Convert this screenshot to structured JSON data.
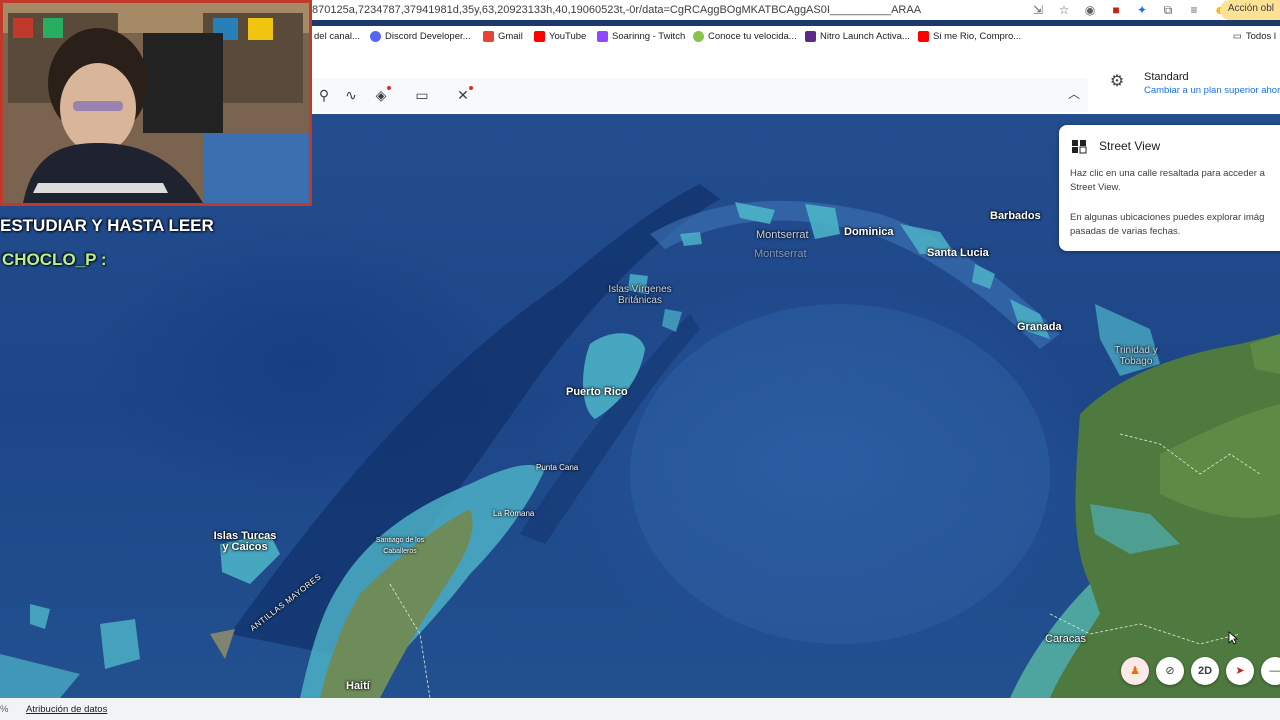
{
  "browser": {
    "url": "870125a,7234787,37941981d,35y,63,20923133h,40,19060523t,-0r/data=CgRCAggBOgMKATBCAggAS0I__________ARAA",
    "action_button": "Acción obl",
    "toolbar_icons": [
      "install-icon",
      "star-icon",
      "extension-icon",
      "pdf-icon",
      "sync-icon",
      "puzzle-icon",
      "media-icon",
      "avatar-icon"
    ]
  },
  "bookmarks": {
    "items": [
      {
        "label": "del canal...",
        "color": "#ffffff"
      },
      {
        "label": "Discord Developer...",
        "color": "#5865f2"
      },
      {
        "label": "Gmail",
        "color": "#ea4335"
      },
      {
        "label": "YouTube",
        "color": "#ff0000"
      },
      {
        "label": "Soarinng - Twitch",
        "color": "#9146ff"
      },
      {
        "label": "Conoce tu velocida...",
        "color": "#8bc34a"
      },
      {
        "label": "Nitro Launch Activa...",
        "color": "#5b2a86"
      },
      {
        "label": "Si me Rio, Compro...",
        "color": "#ff0000"
      }
    ],
    "all_label": "Todos l"
  },
  "earth": {
    "plan_title": "Standard",
    "plan_link": "Cambiar a un plan superior ahor",
    "tools": [
      "pin-icon",
      "path-icon",
      "layers-icon",
      "ruler-icon",
      "satellite-icon"
    ]
  },
  "street_view": {
    "title": "Street View",
    "p1": "Haz clic en una calle resaltada para acceder a Street View.",
    "p2": "En algunas ubicaciones puedes explorar imág pasadas de varias fechas."
  },
  "map_labels": {
    "barbados": "Barbados",
    "dominica": "Dominica",
    "montserrat": "Montserrat",
    "montserrat2": "Montserrat",
    "santa_lucia": "Santa Lucia",
    "granada": "Granada",
    "trinidad": "Trinidad y Tobago",
    "islas_virgenes": "Islas Vírgenes Británicas",
    "puerto_rico": "Puerto Rico",
    "punta_cana": "Punta Cana",
    "la_romana": "La Romana",
    "santiago": "Santiago de los Caballeros",
    "turcas": "Islas Turcas y Caicos",
    "antillas": "ANTILLAS MAYORES",
    "haiti": "Haití",
    "caracas": "Caracas"
  },
  "controls": {
    "two_d": "2D"
  },
  "footer": {
    "pct": "%",
    "attribution": "Atribución de datos"
  },
  "overlay": {
    "line1": "ESTUDIAR Y HASTA LEER",
    "line2": "CHOCLO_P :"
  }
}
